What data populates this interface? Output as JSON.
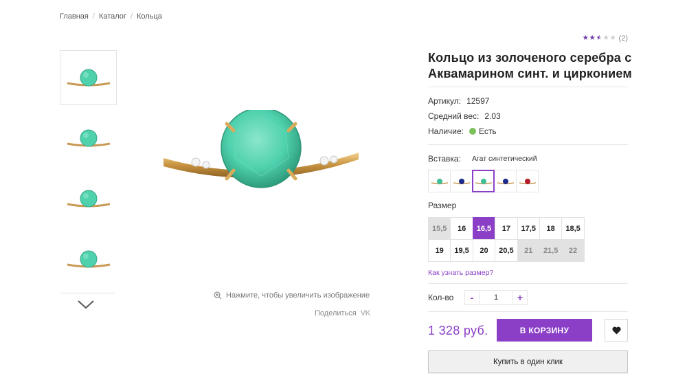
{
  "breadcrumb": [
    {
      "label": "Главная"
    },
    {
      "label": "Каталог"
    },
    {
      "label": "Кольца"
    }
  ],
  "breadcrumb_sep": "/",
  "gallery": {
    "thumbnails": [
      "ring-thumb-1",
      "ring-thumb-2",
      "ring-thumb-3",
      "ring-thumb-4"
    ],
    "active_index": 0,
    "next_icon": "chevron-down-icon",
    "zoom_hint": "Нажмите, чтобы увеличить изображение",
    "share_label": "Поделиться",
    "share_icon": "vk-icon",
    "share_icon_text": "VK"
  },
  "product": {
    "rating_stars": 2.5,
    "rating_max": 5,
    "reviews_count": "(2)",
    "title": "Кольцо из золоченого серебра с Аквамарином синт. и цирконием",
    "specs": [
      {
        "label": "Артикул:",
        "value": "12597"
      },
      {
        "label": "Средний вес:",
        "value": "2.03"
      },
      {
        "label": "Наличие:",
        "value": "Есть"
      }
    ],
    "availability_color": "#7cc05a",
    "insert_label": "Вставка:",
    "insert_value": "Агат синтетический",
    "insert_options": [
      {
        "stone_color": "#3fbf97",
        "selected": false
      },
      {
        "stone_color": "#1d2a8a",
        "selected": false
      },
      {
        "stone_color": "#3fbf97",
        "selected": true
      },
      {
        "stone_color": "#1d2a8a",
        "selected": false
      },
      {
        "stone_color": "#b51c2a",
        "selected": false
      }
    ],
    "size_label": "Размер",
    "sizes": [
      {
        "v": "15,5",
        "state": "na"
      },
      {
        "v": "16",
        "state": "ok"
      },
      {
        "v": "16,5",
        "state": "sel"
      },
      {
        "v": "17",
        "state": "ok"
      },
      {
        "v": "17,5",
        "state": "ok"
      },
      {
        "v": "18",
        "state": "ok"
      },
      {
        "v": "18,5",
        "state": "ok"
      },
      {
        "v": "19",
        "state": "ok"
      },
      {
        "v": "19,5",
        "state": "ok"
      },
      {
        "v": "20",
        "state": "ok"
      },
      {
        "v": "20,5",
        "state": "ok"
      },
      {
        "v": "21",
        "state": "na"
      },
      {
        "v": "21,5",
        "state": "na"
      },
      {
        "v": "22",
        "state": "na"
      }
    ],
    "size_help": "Как узнать размер?",
    "qty_label": "Кол-во",
    "qty_minus": "-",
    "qty_value": "1",
    "qty_plus": "+",
    "price": "1 328 руб.",
    "cart_button": "В КОРЗИНУ",
    "wishlist_icon": "heart-icon",
    "one_click_button": "Купить в один клик"
  },
  "colors": {
    "accent": "#8a3fc6",
    "gem": "#4fd1ad",
    "gold": "#d4a15a"
  }
}
